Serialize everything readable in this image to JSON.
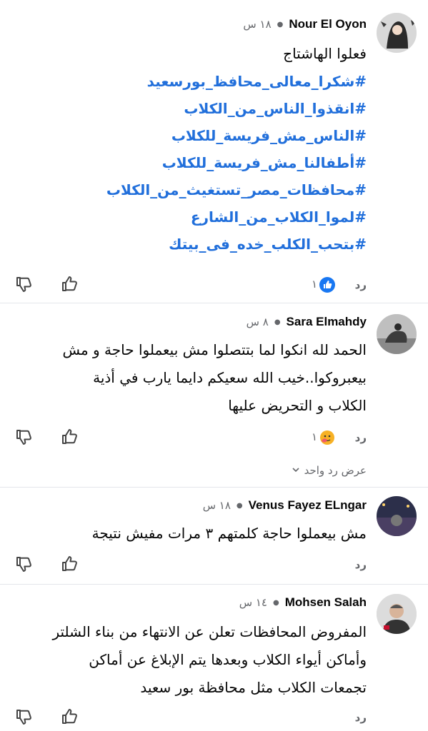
{
  "comments": [
    {
      "author": "Nour El Oyon",
      "time": "١٨ س",
      "text_intro": "فعلوا الهاشتاج",
      "hashtags": [
        "#شكرا_معالى_محافظ_بورسعيد",
        "#انقذوا_الناس_من_الكلاب",
        "#الناس_مش_فريسة_للكلاب",
        "#أطفالنا_مش_فريسة_للكلاب",
        "#محافظات_مصر_تستغيث_من_الكلاب",
        "#لموا_الكلاب_من_الشارع",
        "#بتحب_الكلب_خده_فى_بيتك"
      ],
      "reply_label": "رد",
      "reaction_count": "١",
      "reaction_type": "like-icon"
    },
    {
      "author": "Sara Elmahdy",
      "time": "٨ س",
      "text_lines": [
        "الحمد لله انكوا لما بتتصلوا مش بيعملوا حاجة و مش",
        "بيعبروكوا..خيب الله سعيكم دايما يارب في أذية",
        "الكلاب و التحريض عليها"
      ],
      "reply_label": "رد",
      "reaction_count": "١",
      "reaction_type": "care-icon",
      "view_replies": "عرض رد واحد"
    },
    {
      "author": "Venus Fayez ELngar",
      "time": "١٨ س",
      "text_lines": [
        "مش بيعملوا حاجة كلمتهم ٣ مرات مفيش نتيجة"
      ],
      "reply_label": "رد"
    },
    {
      "author": "Mohsen Salah",
      "time": "١٤ س",
      "text_lines": [
        "المفروض المحافظات تعلن عن الانتهاء من بناء الشلتر",
        "وأماكن أيواء الكلاب وبعدها يتم الإبلاغ عن أماكن",
        "تجمعات الكلاب مثل محافظة بور سعيد"
      ],
      "reply_label": "رد"
    }
  ],
  "colors": {
    "hashtag": "#216fdb",
    "muted": "#65676b",
    "like_blue": "#1877f2"
  }
}
